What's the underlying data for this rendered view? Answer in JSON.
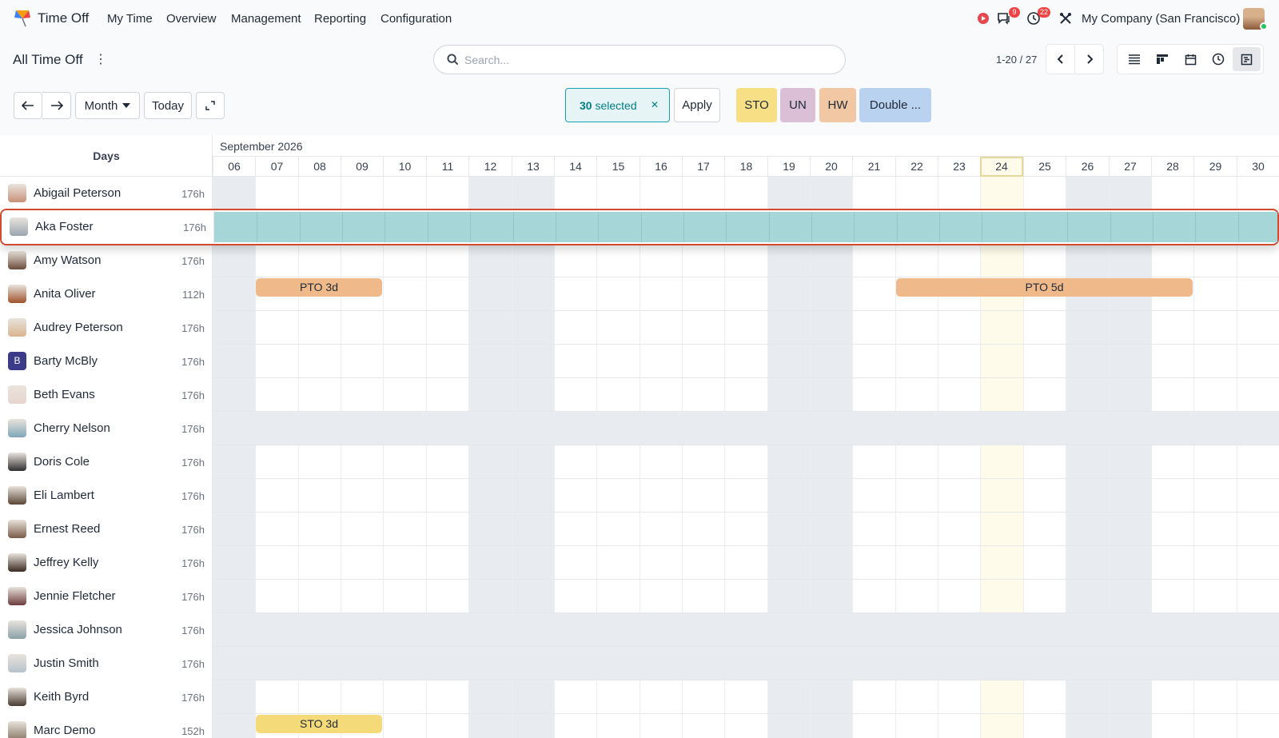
{
  "app": {
    "name": "Time Off",
    "menu": [
      "My Time",
      "Overview",
      "Management",
      "Reporting",
      "Configuration"
    ],
    "company": "My Company (San Francisco)",
    "badges": {
      "messages": "9",
      "activities": "22"
    }
  },
  "control": {
    "title": "All Time Off",
    "search_placeholder": "Search...",
    "pager": "1-20 / 27",
    "scale": "Month",
    "today": "Today",
    "selected": {
      "count": "30",
      "label": "selected"
    },
    "apply": "Apply",
    "tags": [
      {
        "label": "STO",
        "color": "#f7df86"
      },
      {
        "label": "UN",
        "color": "#dbbfd6"
      },
      {
        "label": "HW",
        "color": "#f2c7a4"
      },
      {
        "label": "Double ...",
        "color": "#b9d2ef"
      }
    ]
  },
  "gantt": {
    "header_left": "Days",
    "month": "September 2026",
    "days": [
      "06",
      "07",
      "08",
      "09",
      "10",
      "11",
      "12",
      "13",
      "14",
      "15",
      "16",
      "17",
      "18",
      "19",
      "20",
      "21",
      "22",
      "23",
      "24",
      "25",
      "26",
      "27",
      "28",
      "29",
      "30"
    ],
    "weekend_days": [
      "06",
      "12",
      "13",
      "19",
      "20",
      "26",
      "27"
    ],
    "today": "24",
    "employees": [
      {
        "name": "Abigail Peterson",
        "hours": "176h"
      },
      {
        "name": "Aka Foster",
        "hours": "176h",
        "selected": true
      },
      {
        "name": "Amy Watson",
        "hours": "176h"
      },
      {
        "name": "Anita Oliver",
        "hours": "112h"
      },
      {
        "name": "Audrey Peterson",
        "hours": "176h"
      },
      {
        "name": "Barty McBly",
        "hours": "176h",
        "initial": "B"
      },
      {
        "name": "Beth Evans",
        "hours": "176h"
      },
      {
        "name": "Cherry Nelson",
        "hours": "176h",
        "unavailable": true
      },
      {
        "name": "Doris Cole",
        "hours": "176h"
      },
      {
        "name": "Eli Lambert",
        "hours": "176h"
      },
      {
        "name": "Ernest Reed",
        "hours": "176h"
      },
      {
        "name": "Jeffrey Kelly",
        "hours": "176h"
      },
      {
        "name": "Jennie Fletcher",
        "hours": "176h"
      },
      {
        "name": "Jessica Johnson",
        "hours": "176h",
        "unavailable": true
      },
      {
        "name": "Justin Smith",
        "hours": "176h",
        "unavailable": true
      },
      {
        "name": "Keith Byrd",
        "hours": "176h"
      },
      {
        "name": "Marc Demo",
        "hours": "152h"
      }
    ],
    "leaves": [
      {
        "employee": "Anita Oliver",
        "label": "PTO 3d",
        "type": "pto",
        "start": "07",
        "end": "09"
      },
      {
        "employee": "Anita Oliver",
        "label": "PTO 5d",
        "type": "pto",
        "start": "22",
        "end": "28"
      },
      {
        "employee": "Marc Demo",
        "label": "STO 3d",
        "type": "sto",
        "start": "07",
        "end": "09"
      }
    ]
  }
}
